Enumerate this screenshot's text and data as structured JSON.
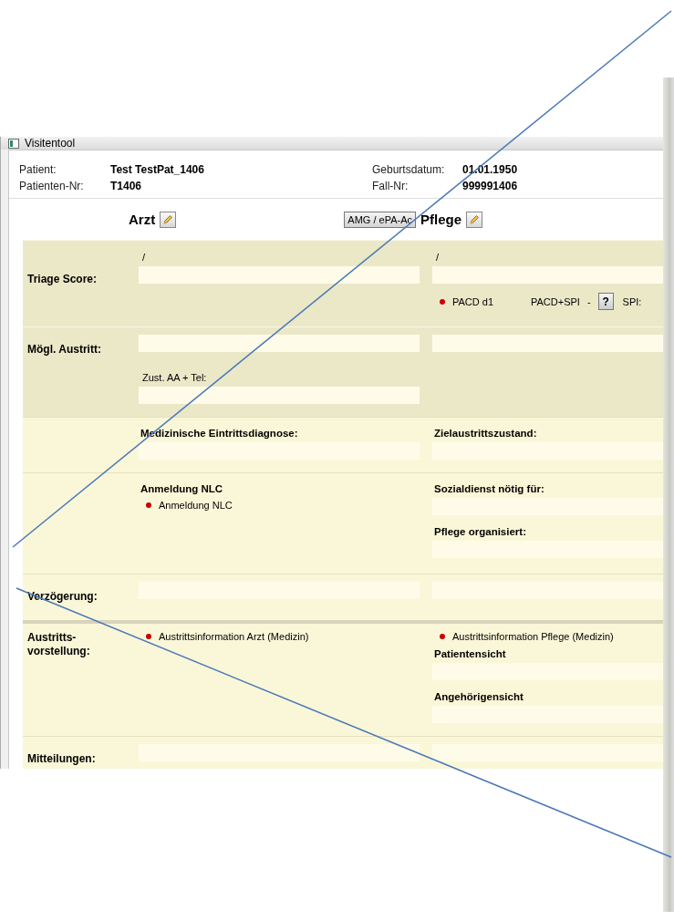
{
  "window": {
    "title": "Visitentool"
  },
  "patient": [
    {
      "label": "Patient:",
      "value": "Test TestPat_1406"
    },
    {
      "label": "Geburtsdatum:",
      "value": "01.01.1950"
    },
    {
      "label": "Patienten-Nr:",
      "value": "T1406"
    },
    {
      "label": "Fall-Nr:",
      "value": "999991406"
    }
  ],
  "columns": {
    "arzt": "Arzt",
    "button": "AMG / ePA-Ac",
    "pflege": "Pflege"
  },
  "rows": [
    {
      "label": "Triage Score:",
      "shaded": true,
      "arzt": [
        {
          "kind": "caption",
          "text": "/"
        },
        {
          "kind": "field"
        }
      ],
      "pflege": [
        {
          "kind": "caption",
          "text": "/"
        },
        {
          "kind": "field"
        },
        {
          "kind": "line",
          "parts": [
            {
              "kind": "bullet",
              "text": "PACD d1"
            },
            {
              "kind": "text",
              "text": "PACD+SPI"
            },
            {
              "kind": "text",
              "text": "-"
            },
            {
              "kind": "help",
              "text": "?"
            },
            {
              "kind": "text",
              "text": "SPI:"
            }
          ]
        }
      ]
    },
    {
      "label": "Mögl. Austritt:",
      "shaded": true,
      "arzt": [
        {
          "kind": "field"
        },
        {
          "kind": "caption",
          "text": "Zust. AA + Tel:"
        },
        {
          "kind": "field"
        }
      ],
      "pflege": [
        {
          "kind": "field"
        }
      ]
    },
    {
      "label": "",
      "shaded": false,
      "arzt": [
        {
          "kind": "heading",
          "text": "Medizinische Eintrittsdiagnose:"
        },
        {
          "kind": "field"
        }
      ],
      "pflege": [
        {
          "kind": "heading",
          "text": "Zielaustrittszustand:"
        },
        {
          "kind": "field"
        }
      ]
    },
    {
      "label": "",
      "shaded": false,
      "arzt": [
        {
          "kind": "heading",
          "text": "Anmeldung NLC"
        },
        {
          "kind": "bullet",
          "text": "Anmeldung NLC"
        }
      ],
      "pflege": [
        {
          "kind": "heading",
          "text": "Sozialdienst nötig für:"
        },
        {
          "kind": "field"
        },
        {
          "kind": "heading",
          "text": "Pflege organisiert:"
        },
        {
          "kind": "field"
        }
      ]
    },
    {
      "label": "Verzögerung:",
      "shaded": false,
      "arzt": [
        {
          "kind": "field"
        }
      ],
      "pflege": [
        {
          "kind": "field"
        }
      ]
    },
    {
      "label": "Austritts-vorstellung:",
      "shaded": false,
      "thick_divider": true,
      "arzt": [
        {
          "kind": "bullet",
          "text": "Austrittsinformation Arzt (Medizin)"
        }
      ],
      "pflege": [
        {
          "kind": "bullet",
          "text": "Austrittsinformation Pflege (Medizin)"
        },
        {
          "kind": "heading",
          "text": "Patientensicht"
        },
        {
          "kind": "field"
        },
        {
          "kind": "heading",
          "text": "Angehörigensicht"
        },
        {
          "kind": "field"
        }
      ]
    },
    {
      "label": "Mitteilungen:",
      "shaded": false,
      "arzt": [
        {
          "kind": "field"
        }
      ],
      "pflege": [
        {
          "kind": "field"
        }
      ]
    }
  ]
}
